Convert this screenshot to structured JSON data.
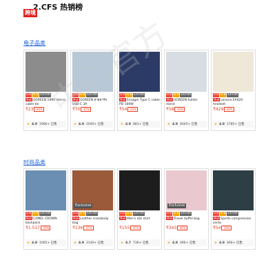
{
  "heading": "2.CFS 热销榜",
  "tag": "跨境",
  "watermark": "中心官方",
  "sections": [
    {
      "title": "电子品类",
      "products": [
        {
          "ribbon": "",
          "badges": [
            "0.8",
            "8.8",
            "EXTRA"
          ],
          "title": "UGREEN 1990 Velcro cable tie",
          "price": "₹23",
          "pct": "-40%",
          "rating": "4.9",
          "sold": "1966+ 已售",
          "color": "#8c8c8c"
        },
        {
          "ribbon": "",
          "badges": [
            "0.8",
            "8.8",
            "EXTRA"
          ],
          "title": "UGREEN สายชาร์จ USB-C 3A",
          "price": "₹70",
          "pct": "-35%",
          "rating": "4.9",
          "sold": "2040+ 已售",
          "color": "#b9c8d6"
        },
        {
          "ribbon": "",
          "badges": [
            "0.8",
            "8.8",
            "EXTRA"
          ],
          "title": "Essager Type C cable PD 100W",
          "price": "₹54",
          "pct": "-25%",
          "rating": "4.9",
          "sold": "881+ 已售",
          "color": "#2c3a66"
        },
        {
          "ribbon": "",
          "badges": [
            "0.8",
            "8.8",
            "EXTRA"
          ],
          "title": "UGREEN holder stand",
          "price": "₹58",
          "pct": "-30%",
          "rating": "4.9",
          "sold": "4045+ 已售",
          "color": "#d7dde3"
        },
        {
          "ribbon": "",
          "badges": [
            "0.8",
            "8.8",
            "EXTRA"
          ],
          "title": "Lenovo EA420 headset",
          "price": "₹429",
          "pct": "-30%",
          "rating": "4.9",
          "sold": "1785+ 已售",
          "color": "#efe7d8"
        }
      ]
    },
    {
      "title": "时尚品类",
      "products": [
        {
          "ribbon": "",
          "badges": [
            "0.8",
            "8.8",
            "EXTRA"
          ],
          "title": "CAMEL CROWN backpack",
          "price": "₹1.517",
          "pct": "-20%",
          "rating": "4.9",
          "sold": "1065+ 已售",
          "color": "#6b8fb2"
        },
        {
          "ribbon": "Exclusive",
          "badges": [
            "0.8",
            "8.8",
            "EXTRA"
          ],
          "title": "Leather crossbody bag",
          "price": "₹136",
          "pct": "-25%",
          "rating": "4.9",
          "sold": "2140+ 已售",
          "color": "#9b5a3a"
        },
        {
          "ribbon": "",
          "badges": [
            "0.8",
            "8.8",
            "EXTRA"
          ],
          "title": "Men's silk shirt",
          "price": "₹155",
          "pct": "-35%",
          "rating": "4.7",
          "sold": "736+ 已售",
          "color": "#1d1d1d"
        },
        {
          "ribbon": "Exclusive",
          "badges": [
            "0.8",
            "8.8",
            "EXTRA"
          ],
          "title": "Travel duffel bag",
          "price": "₹343",
          "pct": "-40%",
          "rating": "4.9",
          "sold": "496+ 已售",
          "color": "#e9c9cf"
        },
        {
          "ribbon": "",
          "badges": [
            "0.8",
            "8.8",
            "EXTRA"
          ],
          "title": "Sports compression socks",
          "price": "₹54",
          "pct": "-30%",
          "rating": "4.9",
          "sold": "466+ 已售",
          "color": "#2e3e45"
        }
      ]
    }
  ]
}
